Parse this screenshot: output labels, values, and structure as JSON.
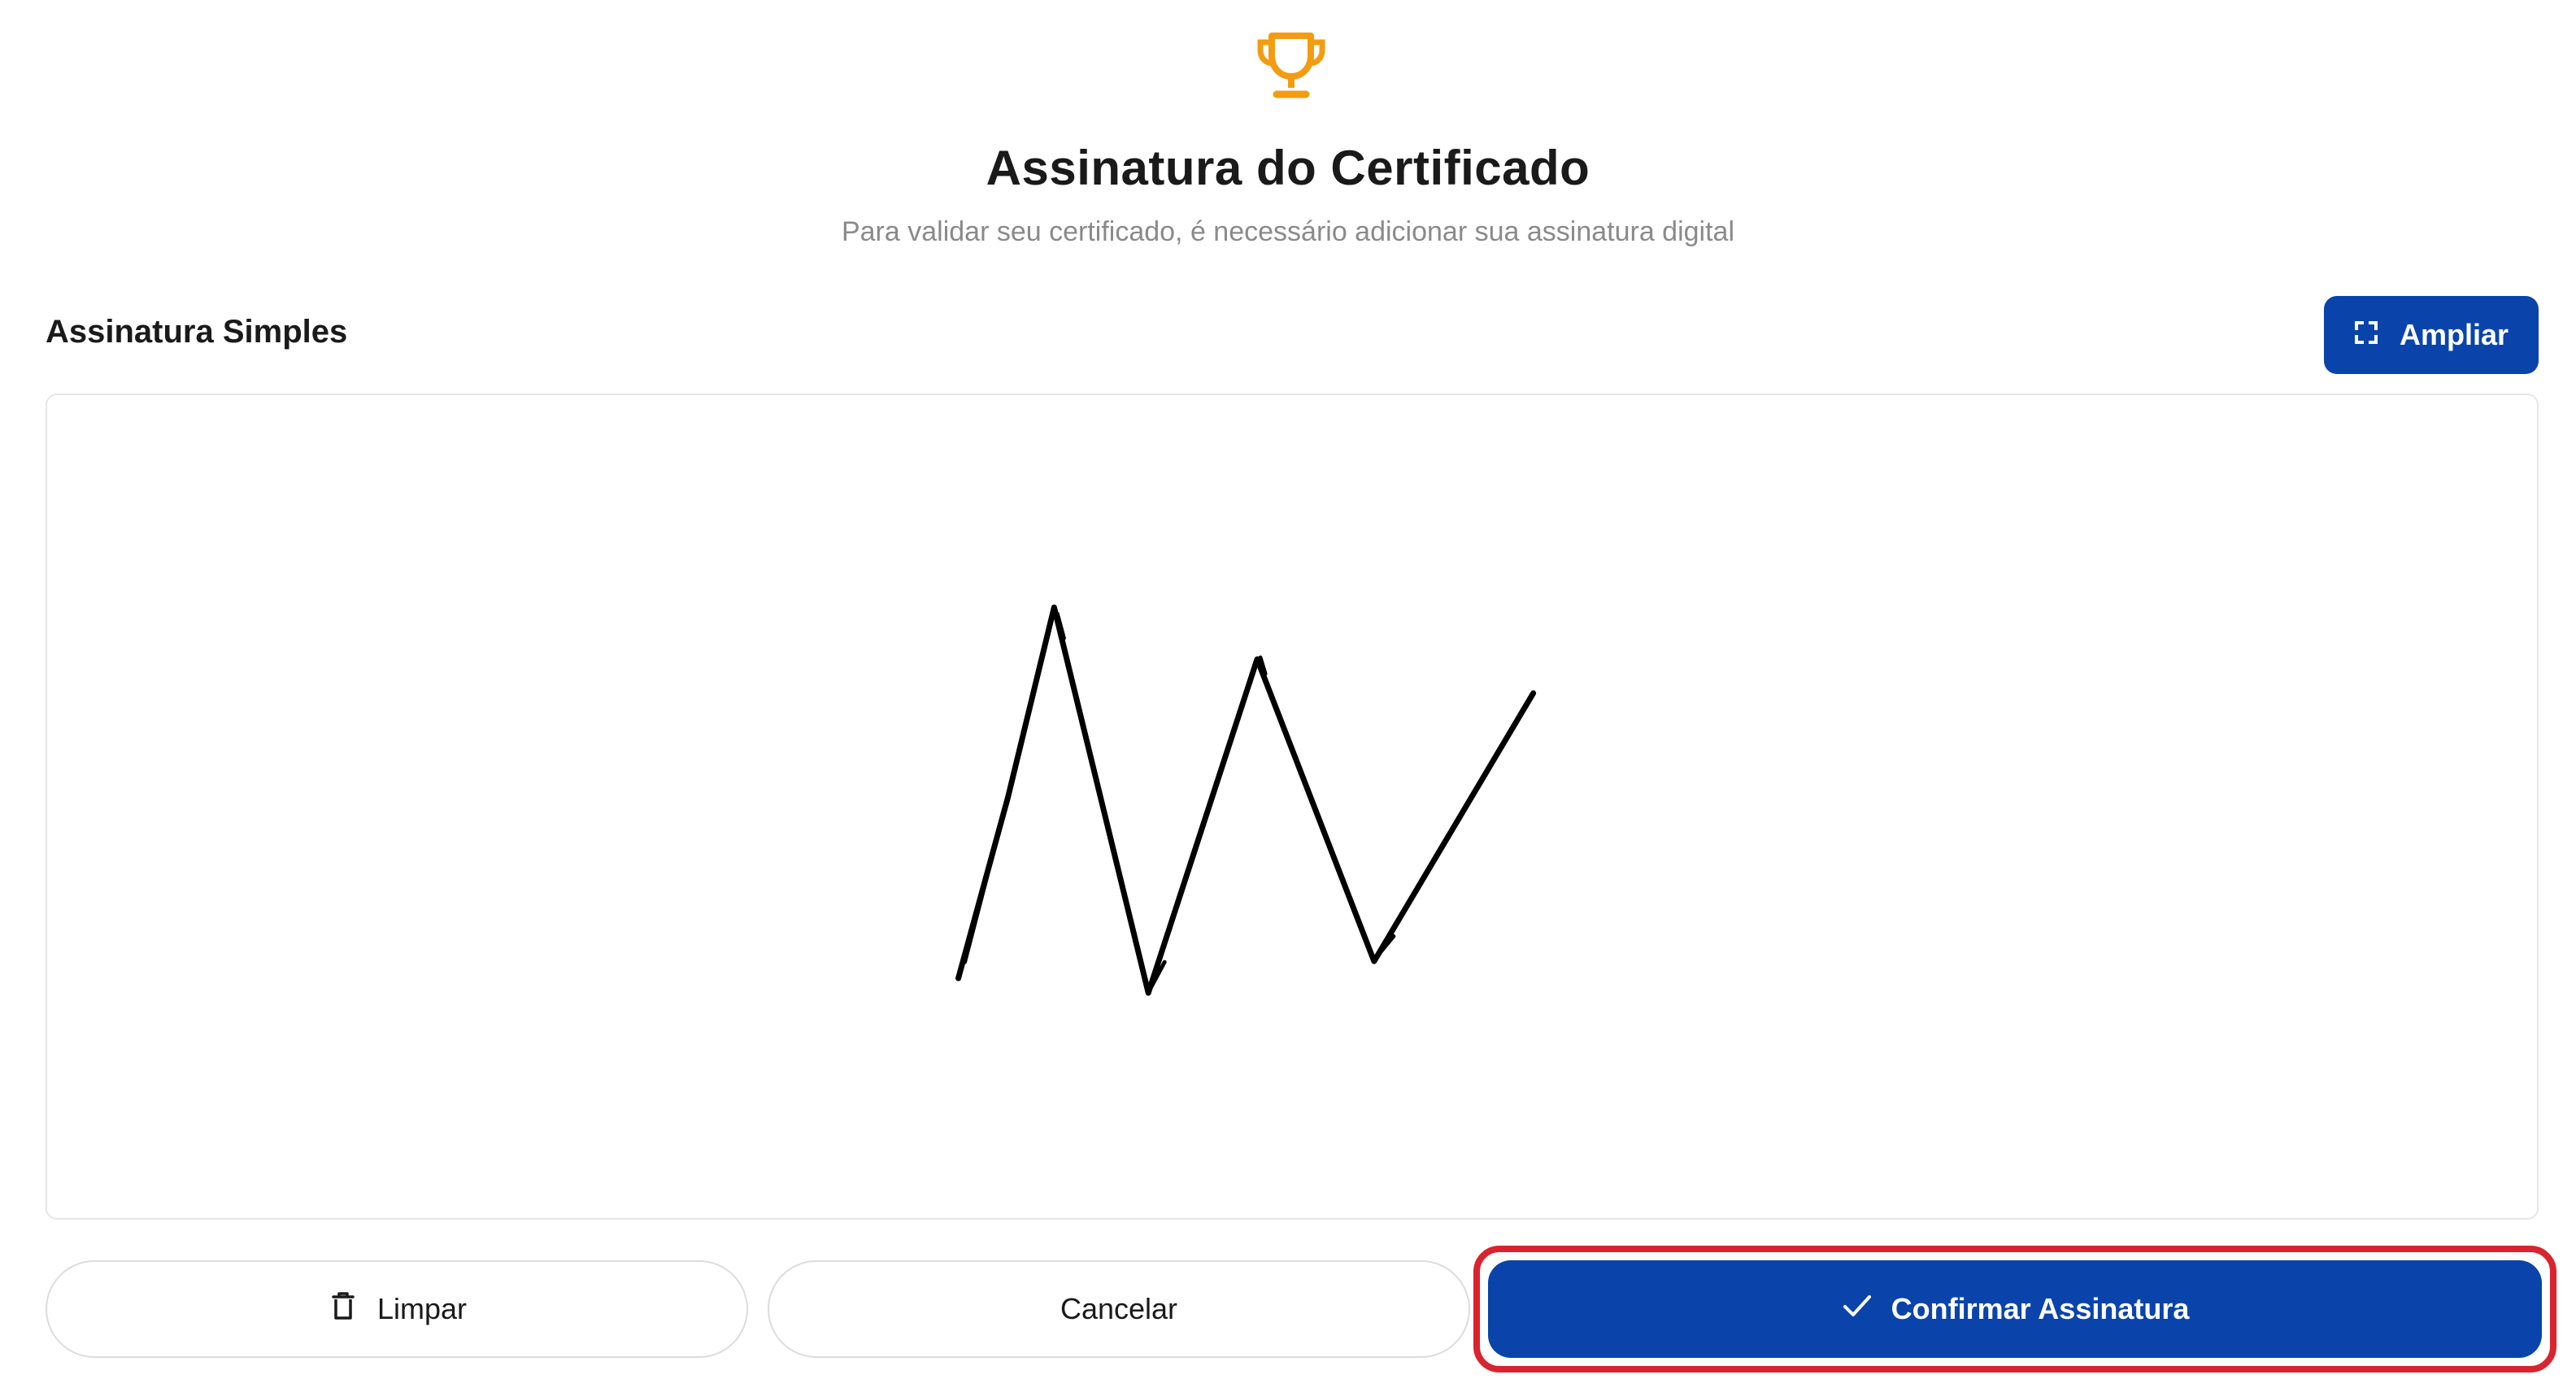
{
  "header": {
    "icon": "trophy-icon",
    "title": "Assinatura do Certificado",
    "subtitle": "Para validar seu certificado, é necessário adicionar sua assinatura digital"
  },
  "section": {
    "title": "Assinatura Simples",
    "expand_button": {
      "icon": "expand-icon",
      "label": "Ampliar"
    }
  },
  "signature_pad": {
    "has_signature": true
  },
  "actions": {
    "clear": {
      "icon": "trash-icon",
      "label": "Limpar"
    },
    "cancel": {
      "label": "Cancelar"
    },
    "confirm": {
      "icon": "check-icon",
      "label": "Confirmar Assinatura"
    }
  },
  "colors": {
    "accent": "#0A44AB",
    "trophy": "#F39C12",
    "highlight": "#D9232E",
    "subtitle": "#8A8A8A"
  }
}
